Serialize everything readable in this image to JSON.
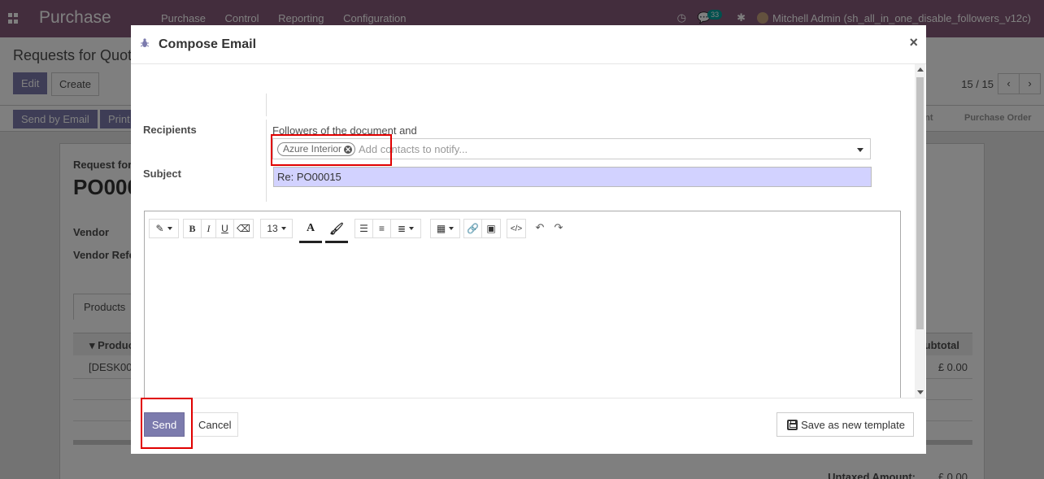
{
  "app": {
    "brand": "Purchase",
    "menu": [
      "Purchase",
      "Control",
      "Reporting",
      "Configuration"
    ],
    "chat_count": "33",
    "user": "Mitchell Admin (sh_all_in_one_disable_followers_v12c)"
  },
  "control_panel": {
    "breadcrumb": "Requests for Quot",
    "edit_label": "Edit",
    "create_label": "Create",
    "pager": "15 / 15"
  },
  "statusbar": {
    "send_by_email": "Send by Email",
    "print": "Print",
    "stage_1": "ent",
    "stage_2": "Purchase Order"
  },
  "sheet": {
    "title_small": "Request for",
    "title_big": "PO000",
    "vendor_label": "Vendor",
    "vendor_ref_label": "Vendor Refe",
    "tab_products": "Products",
    "col_product": "Product",
    "col_subtotal": "ubtotal",
    "row_product": "[DESK00",
    "row_subtotal": "£ 0.00",
    "untaxed_label": "Untaxed Amount:",
    "untaxed_value": "£ 0.00"
  },
  "modal": {
    "title": "Compose Email",
    "close": "×",
    "recipients_label": "Recipients",
    "followers_text": "Followers of the document and",
    "tag_label": "Azure Interior",
    "contacts_placeholder": "Add contacts to notify...",
    "subject_label": "Subject",
    "subject_value": "Re: PO00015",
    "font_size": "13",
    "send_label": "Send",
    "cancel_label": "Cancel",
    "save_template_label": "Save as new template"
  },
  "colors": {
    "navbar": "#875a7b",
    "primary": "#7c7bad",
    "subject_bg": "#d2d2ff",
    "highlight": "#e00000"
  }
}
